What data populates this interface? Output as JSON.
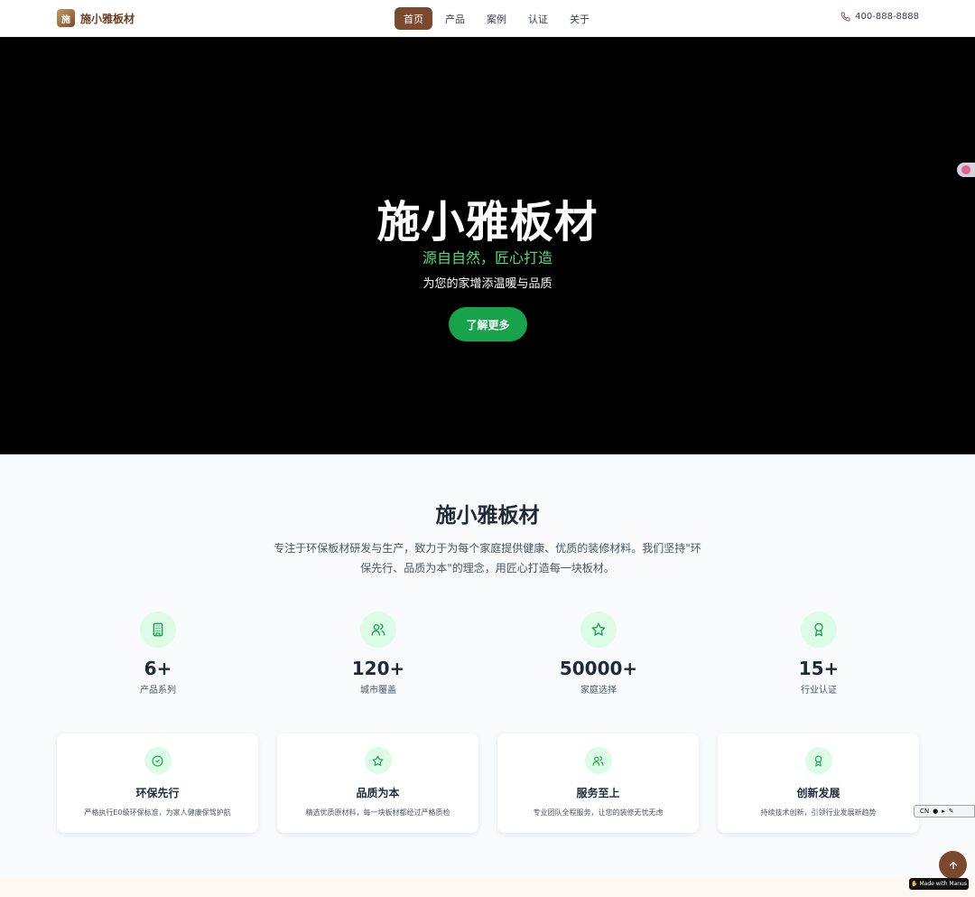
{
  "nav": {
    "brand_logo_char": "施",
    "brand_name": "施小雅板材",
    "links": [
      {
        "label": "首页",
        "active": true
      },
      {
        "label": "产品",
        "active": false
      },
      {
        "label": "案例",
        "active": false
      },
      {
        "label": "认证",
        "active": false
      },
      {
        "label": "关于",
        "active": false
      }
    ],
    "phone": "400-888-8888",
    "phone_icon": "phone-icon"
  },
  "hero": {
    "title": "施小雅板材",
    "slogan": "源自自然，匠心打造",
    "subtitle": "为您的家增添温暖与品质",
    "button_label": "了解更多"
  },
  "about": {
    "title": "施小雅板材",
    "description": "专注于环保板材研发与生产，致力于为每个家庭提供健康、优质的装修材料。我们坚持\"环保先行、品质为本\"的理念，用匠心打造每一块板材。"
  },
  "stats": [
    {
      "icon": "building-icon",
      "value": "6+",
      "label": "产品系列"
    },
    {
      "icon": "users-icon",
      "value": "120+",
      "label": "城市覆盖"
    },
    {
      "icon": "star-icon",
      "value": "50000+",
      "label": "家庭选择"
    },
    {
      "icon": "award-icon",
      "value": "15+",
      "label": "行业认证"
    }
  ],
  "features": [
    {
      "icon": "check-circle-icon",
      "title": "环保先行",
      "desc": "严格执行E0级环保标准，为家人健康保驾护航"
    },
    {
      "icon": "star-icon",
      "title": "品质为本",
      "desc": "精选优质原材料，每一块板材都经过严格质检"
    },
    {
      "icon": "users-icon",
      "title": "服务至上",
      "desc": "专业团队全程服务，让您的装修无忧无虑"
    },
    {
      "icon": "award-icon",
      "title": "创新发展",
      "desc": "持续技术创新，引领行业发展新趋势"
    }
  ],
  "widgets": {
    "translate_label": "CN",
    "made_with": "Made with Manus"
  },
  "colors": {
    "brand": "#7b4a2e",
    "accent_green": "#16a34a",
    "slogan_green": "#4ade80",
    "icon_bg": "#dcfce7"
  }
}
